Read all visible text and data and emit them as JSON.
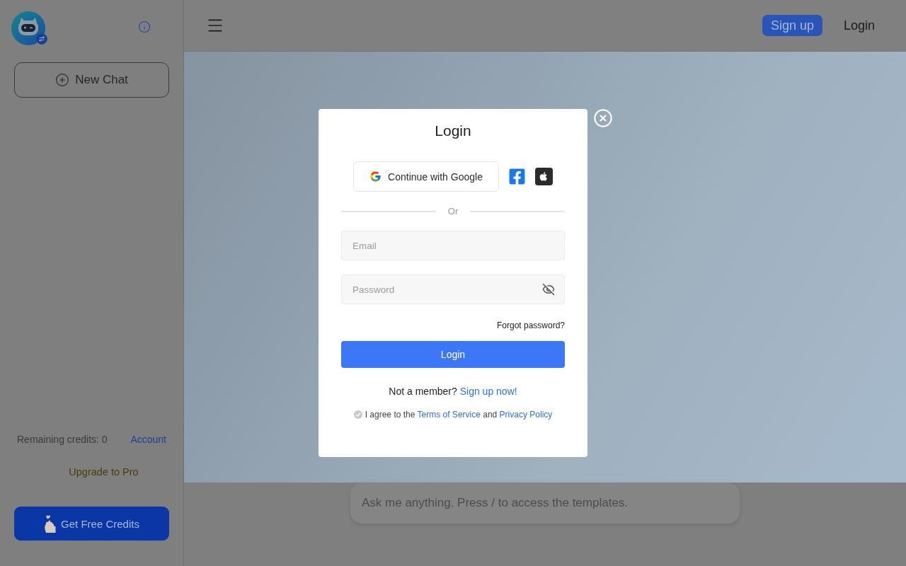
{
  "sidebar": {
    "new_chat_button": "New Chat",
    "credits_label": "Remaining credits: 0",
    "account_link": "Account",
    "upgrade_link": "Upgrade to Pro",
    "free_credits_button": "Get Free Credits"
  },
  "header": {
    "actions": [
      {
        "kind": "filled",
        "label": "Sign up"
      },
      {
        "kind": "plain",
        "label": "Login"
      }
    ]
  },
  "chat_input": {
    "placeholder": "Ask me anything. Press / to access the templates."
  },
  "login_dialog": {
    "title": "Login",
    "google_button": "Continue with Google",
    "social_buttons": [
      {
        "kind": "facebook"
      },
      {
        "kind": "apple"
      }
    ],
    "divider_label": "Or",
    "fields": [
      {
        "kind": "email",
        "placeholder": "Email"
      },
      {
        "kind": "password",
        "placeholder": "Password"
      }
    ],
    "forgot_password_link": "Forgot password?",
    "submit_button": "Login",
    "signup_prompt": {
      "text": "Not a member?",
      "link": "Sign up now!"
    },
    "agreement": {
      "checked": false,
      "parts": [
        {
          "kind": "text",
          "text": "I agree to the"
        },
        {
          "kind": "link",
          "text": "Terms of Service"
        },
        {
          "kind": "text",
          "text": "and"
        },
        {
          "kind": "link",
          "text": "Privacy Policy"
        }
      ]
    }
  }
}
